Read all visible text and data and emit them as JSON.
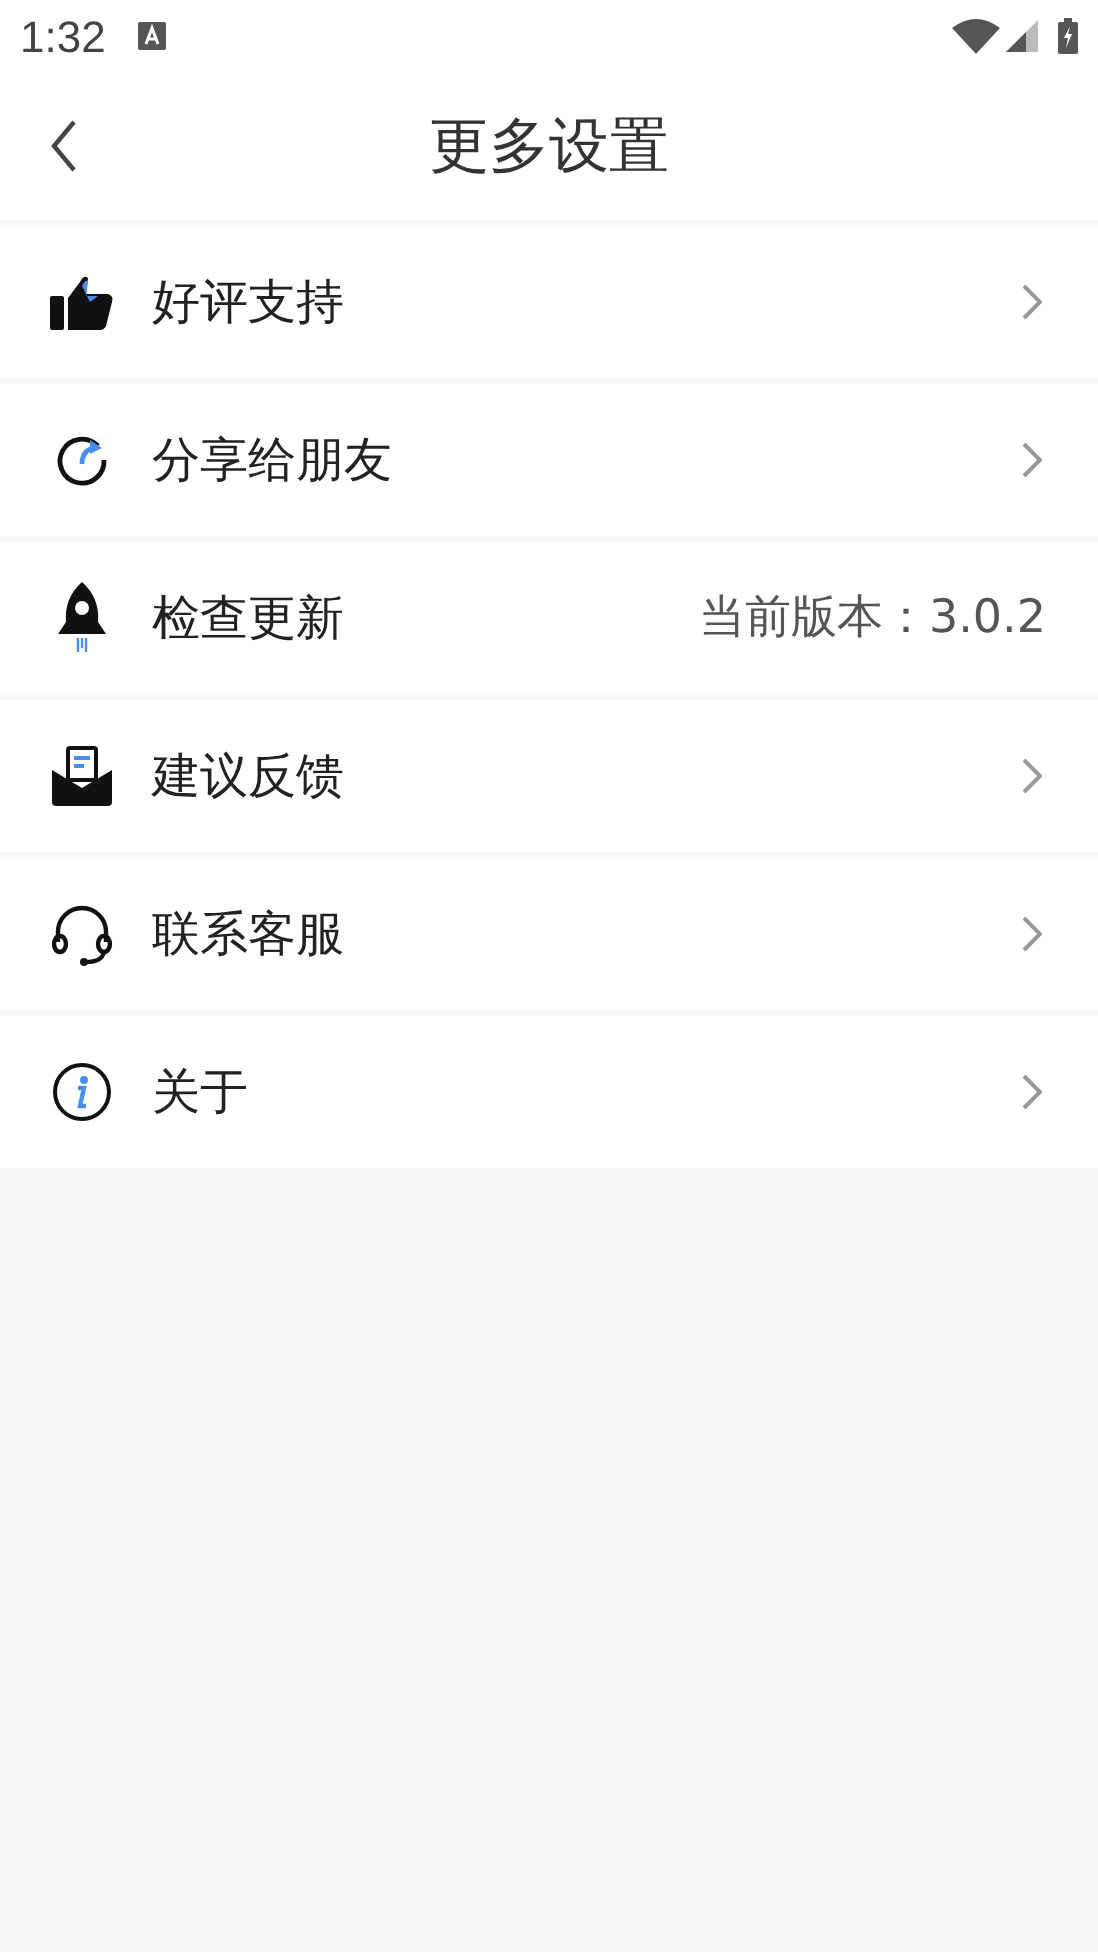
{
  "status_bar": {
    "time": "1:32"
  },
  "header": {
    "title": "更多设置"
  },
  "items": [
    {
      "label": "好评支持",
      "kind": "chevron"
    },
    {
      "label": "分享给朋友",
      "kind": "chevron"
    },
    {
      "label": "检查更新",
      "kind": "value",
      "value": "当前版本：3.0.2"
    },
    {
      "label": "建议反馈",
      "kind": "chevron"
    },
    {
      "label": "联系客服",
      "kind": "chevron"
    },
    {
      "label": "关于",
      "kind": "chevron"
    }
  ]
}
